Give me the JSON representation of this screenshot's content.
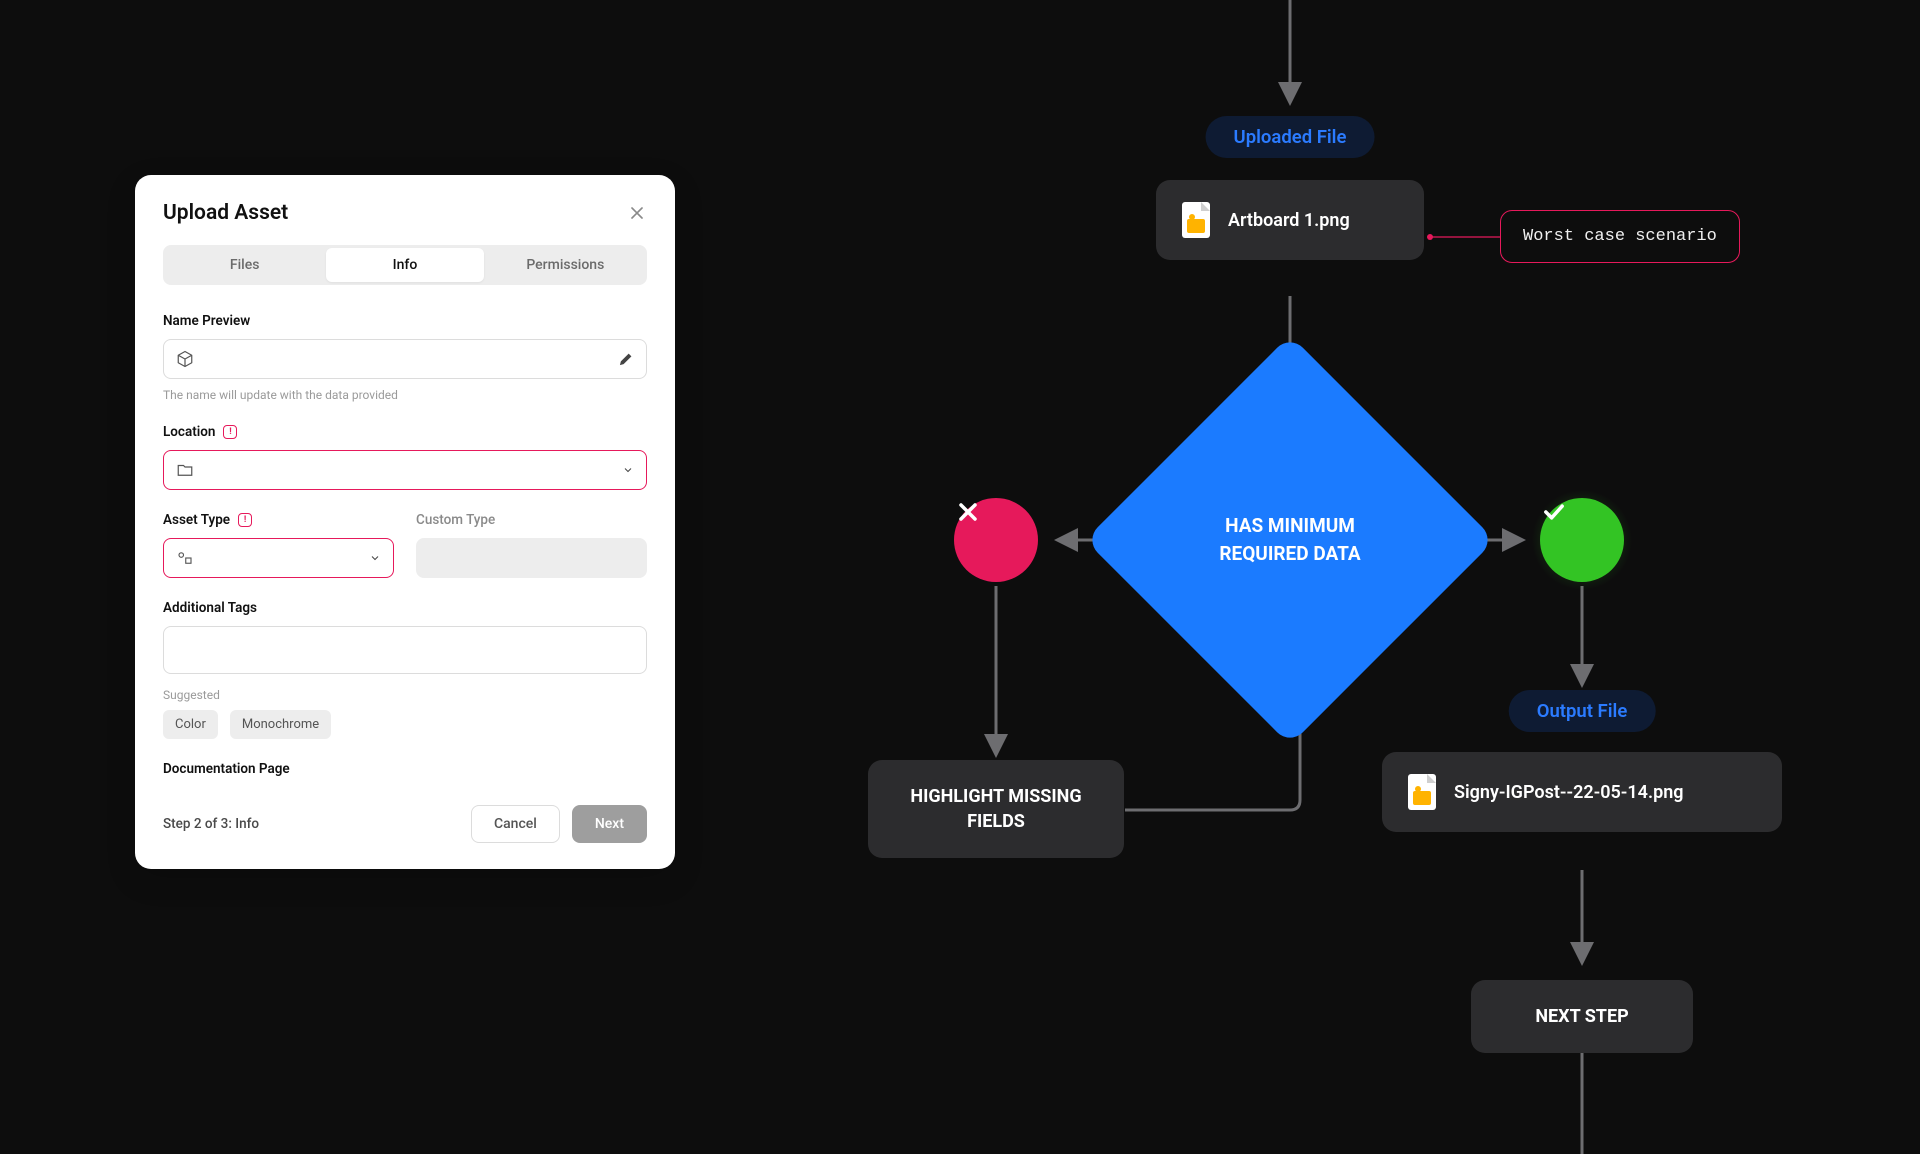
{
  "modal": {
    "title": "Upload Asset",
    "tabs": {
      "files": "Files",
      "info": "Info",
      "permissions": "Permissions"
    },
    "name_preview": {
      "label": "Name Preview",
      "helper": "The name will update with the data provided"
    },
    "location": {
      "label": "Location"
    },
    "asset_type": {
      "label": "Asset Type"
    },
    "custom_type": {
      "label": "Custom Type"
    },
    "additional_tags": {
      "label": "Additional Tags"
    },
    "suggested_label": "Suggested",
    "suggested": {
      "color": "Color",
      "mono": "Monochrome"
    },
    "documentation": {
      "label": "Documentation Page"
    },
    "footer": {
      "step": "Step 2 of 3: Info",
      "cancel": "Cancel",
      "next": "Next"
    }
  },
  "flow": {
    "uploaded_pill": "Uploaded File",
    "input_file": "Artboard 1.png",
    "annotation": "Worst case scenario",
    "decision": "HAS MINIMUM REQUIRED DATA",
    "highlight": "HIGHLIGHT MISSING FIELDS",
    "output_pill": "Output File",
    "output_file": "Signy-IGPost--22-05-14.png",
    "next_step": "NEXT STEP"
  }
}
